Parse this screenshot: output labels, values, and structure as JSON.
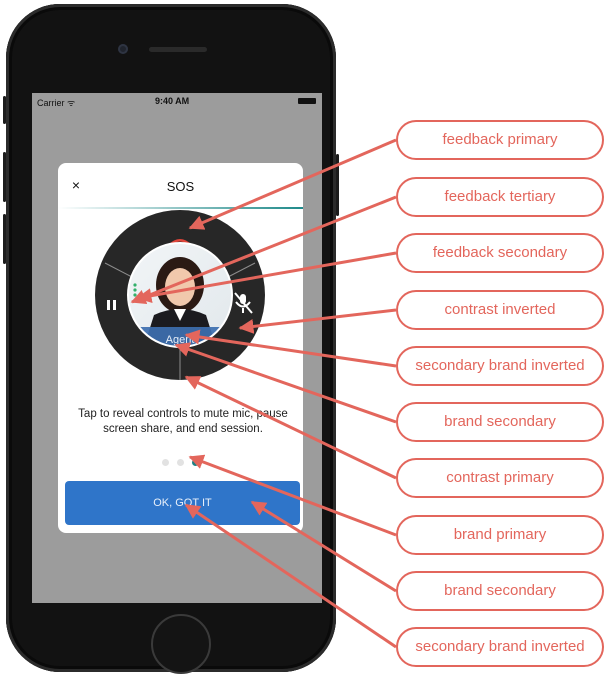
{
  "status_bar": {
    "carrier": "Carrier ᯤ",
    "time": "9:40 AM"
  },
  "dialog": {
    "title": "SOS",
    "close_glyph": "×",
    "agent_label": "Agent",
    "caption": "Tap to reveal controls to mute mic, pause screen share, and end session.",
    "button_label": "OK, GOT IT",
    "page_indicator": {
      "count": 3,
      "active_index": 2
    }
  },
  "icons": [
    "phone-hangup-icon",
    "pause-icon",
    "mic-muted-icon",
    "volume-level-icon",
    "close-icon",
    "wifi-icon",
    "battery-icon"
  ],
  "colors": {
    "brand_primary": "#1e7f83",
    "brand_secondary": "#2f75c9",
    "feedback_primary": "#e0453a",
    "feedback_secondary": "#ffffff",
    "contrast_primary": "#222222",
    "callout": "#e3665c"
  },
  "callouts": [
    "feedback primary",
    "feedback tertiary",
    "feedback secondary",
    "contrast inverted",
    "secondary brand inverted",
    "brand secondary",
    "contrast primary",
    "brand primary",
    "brand secondary",
    "secondary brand inverted"
  ]
}
